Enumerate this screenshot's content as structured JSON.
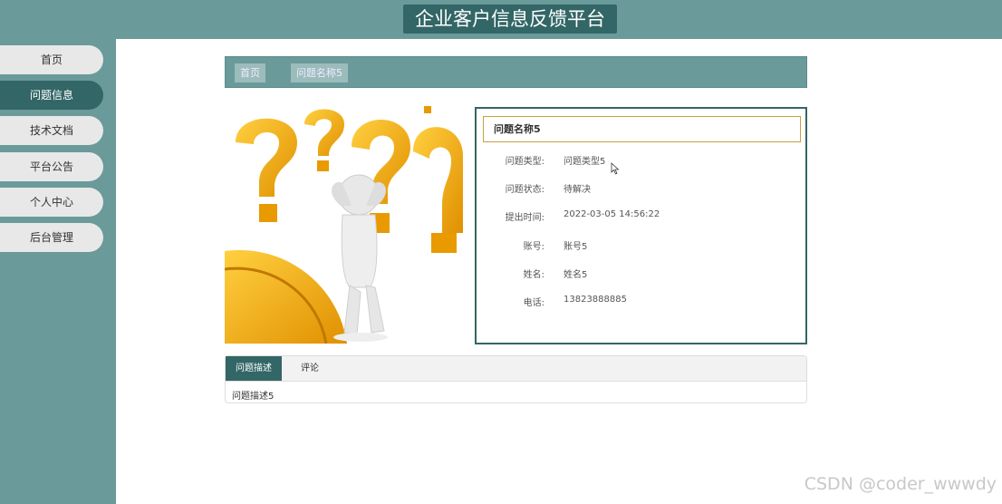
{
  "header": {
    "title": "企业客户信息反馈平台"
  },
  "sidebar": {
    "items": [
      {
        "label": "首页"
      },
      {
        "label": "问题信息"
      },
      {
        "label": "技术文档"
      },
      {
        "label": "平台公告"
      },
      {
        "label": "个人中心"
      },
      {
        "label": "后台管理"
      }
    ],
    "active_index": 1
  },
  "breadcrumb": {
    "home": "首页",
    "current": "问题名称5"
  },
  "detail": {
    "title": "问题名称5",
    "fields": [
      {
        "label": "问题类型:",
        "value": "问题类型5"
      },
      {
        "label": "问题状态:",
        "value": "待解决"
      },
      {
        "label": "提出时间:",
        "value": "2022-03-05 14:56:22"
      },
      {
        "label": "账号:",
        "value": "账号5"
      },
      {
        "label": "姓名:",
        "value": "姓名5"
      },
      {
        "label": "电话:",
        "value": "13823888885"
      }
    ]
  },
  "tabs": {
    "items": [
      {
        "label": "问题描述"
      },
      {
        "label": "评论"
      }
    ],
    "active_index": 0,
    "content": "问题描述5"
  },
  "watermark": "CSDN @coder_wwwdy",
  "colors": {
    "primary": "#336666",
    "secondary": "#6a9a9a",
    "accent": "#c8a040"
  }
}
